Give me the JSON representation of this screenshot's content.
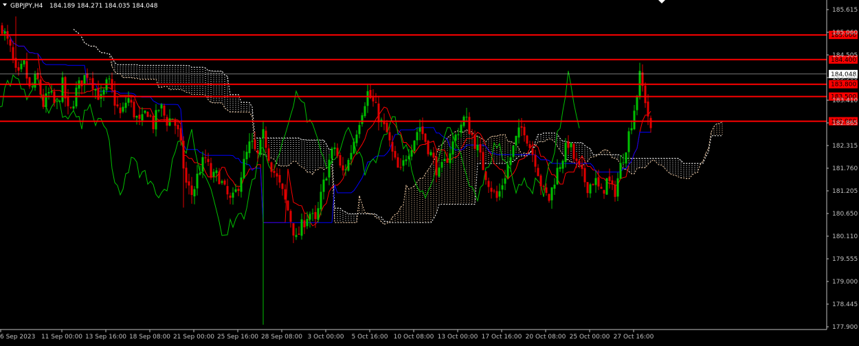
{
  "header": {
    "symbol_label": "GBPJPY,H4",
    "ohlc_text": "184.189 184.271 184.035 184.048"
  },
  "colors": {
    "background": "#000000",
    "bull": "#00c000",
    "bear": "#e00000",
    "hline": "#ff0000",
    "tenkan": "#ff0000",
    "kijun": "#0000ff",
    "chikou": "#00c000",
    "cloud_up": "#ffd8b0",
    "cloud_down": "#ffffff",
    "axis_text": "#c0c0c0",
    "price_line": "#c0c0c0",
    "price_label_bg": "#ffffff",
    "level_label_bg": "#ff0000"
  },
  "chart_data": {
    "type": "candlestick",
    "instrument": "GBPJPY",
    "timeframe": "H4",
    "y_ticks": [
      "185.615",
      "185.060",
      "184.505",
      "183.960",
      "183.410",
      "182.865",
      "182.315",
      "181.760",
      "181.205",
      "180.650",
      "180.110",
      "179.555",
      "179.000",
      "178.445",
      "177.900"
    ],
    "ylim": [
      177.9,
      185.615
    ],
    "x_ticks": [
      "6 Sep 2023",
      "11 Sep 00:00",
      "13 Sep 16:00",
      "18 Sep 08:00",
      "21 Sep 00:00",
      "25 Sep 16:00",
      "28 Sep 08:00",
      "3 Oct 00:00",
      "5 Oct 16:00",
      "10 Oct 08:00",
      "13 Oct 00:00",
      "17 Oct 16:00",
      "20 Oct 08:00",
      "25 Oct 00:00",
      "27 Oct 16:00"
    ],
    "current_price": "184.048",
    "horizontal_levels": [
      {
        "price": 185.0,
        "label": "185.000"
      },
      {
        "price": 184.4,
        "label": "184.400"
      },
      {
        "price": 183.8,
        "label": "183.800"
      },
      {
        "price": 183.5,
        "label": "183.500"
      },
      {
        "price": 182.9,
        "label": "182.900"
      }
    ],
    "close_path": [
      [
        0,
        185.2
      ],
      [
        8,
        184.6
      ],
      [
        14,
        183.9
      ],
      [
        20,
        184.3
      ],
      [
        26,
        183.6
      ],
      [
        32,
        184.0
      ],
      [
        38,
        183.3
      ],
      [
        44,
        183.6
      ],
      [
        50,
        183.2
      ],
      [
        56,
        183.8
      ],
      [
        62,
        183.0
      ],
      [
        68,
        183.6
      ],
      [
        74,
        183.9
      ],
      [
        80,
        184.1
      ],
      [
        86,
        183.7
      ],
      [
        92,
        183.4
      ],
      [
        98,
        183.9
      ],
      [
        104,
        183.4
      ],
      [
        110,
        183.0
      ],
      [
        116,
        183.5
      ],
      [
        122,
        183.1
      ],
      [
        128,
        182.8
      ],
      [
        134,
        183.2
      ],
      [
        140,
        182.8
      ],
      [
        146,
        183.3
      ],
      [
        152,
        182.9
      ],
      [
        158,
        183.0
      ],
      [
        164,
        182.5
      ],
      [
        170,
        181.4
      ],
      [
        176,
        181.1
      ],
      [
        182,
        181.7
      ],
      [
        188,
        182.0
      ],
      [
        194,
        181.5
      ],
      [
        200,
        181.6
      ],
      [
        206,
        181.2
      ],
      [
        212,
        180.9
      ],
      [
        218,
        181.3
      ],
      [
        224,
        181.9
      ],
      [
        230,
        182.4
      ],
      [
        236,
        182.0
      ],
      [
        242,
        182.6
      ],
      [
        248,
        181.9
      ],
      [
        254,
        181.5
      ],
      [
        260,
        181.1
      ],
      [
        266,
        180.6
      ],
      [
        272,
        180.0
      ],
      [
        278,
        180.4
      ],
      [
        284,
        180.7
      ],
      [
        290,
        180.4
      ],
      [
        296,
        181.2
      ],
      [
        302,
        181.9
      ],
      [
        308,
        182.3
      ],
      [
        314,
        181.6
      ],
      [
        320,
        181.9
      ],
      [
        326,
        182.5
      ],
      [
        332,
        183.1
      ],
      [
        338,
        183.6
      ],
      [
        344,
        183.3
      ],
      [
        350,
        182.9
      ],
      [
        356,
        182.6
      ],
      [
        362,
        182.0
      ],
      [
        368,
        181.6
      ],
      [
        374,
        182.1
      ],
      [
        380,
        182.4
      ],
      [
        386,
        182.8
      ],
      [
        392,
        182.4
      ],
      [
        398,
        182.0
      ],
      [
        404,
        181.6
      ],
      [
        410,
        181.9
      ],
      [
        416,
        182.3
      ],
      [
        422,
        182.7
      ],
      [
        428,
        183.0
      ],
      [
        434,
        182.6
      ],
      [
        440,
        182.2
      ],
      [
        446,
        181.7
      ],
      [
        452,
        181.3
      ],
      [
        458,
        181.0
      ],
      [
        464,
        181.5
      ],
      [
        470,
        182.0
      ],
      [
        476,
        182.5
      ],
      [
        482,
        182.8
      ],
      [
        488,
        182.3
      ],
      [
        494,
        181.9
      ],
      [
        500,
        181.2
      ],
      [
        506,
        181.0
      ],
      [
        512,
        181.6
      ],
      [
        518,
        182.0
      ],
      [
        524,
        182.4
      ],
      [
        530,
        181.9
      ],
      [
        536,
        181.6
      ],
      [
        542,
        181.3
      ],
      [
        548,
        181.5
      ],
      [
        554,
        181.1
      ],
      [
        560,
        181.5
      ],
      [
        566,
        181.1
      ],
      [
        572,
        181.8
      ],
      [
        578,
        182.4
      ],
      [
        584,
        183.1
      ],
      [
        590,
        184.0
      ],
      [
        596,
        183.3
      ],
      [
        600,
        182.6
      ]
    ]
  }
}
